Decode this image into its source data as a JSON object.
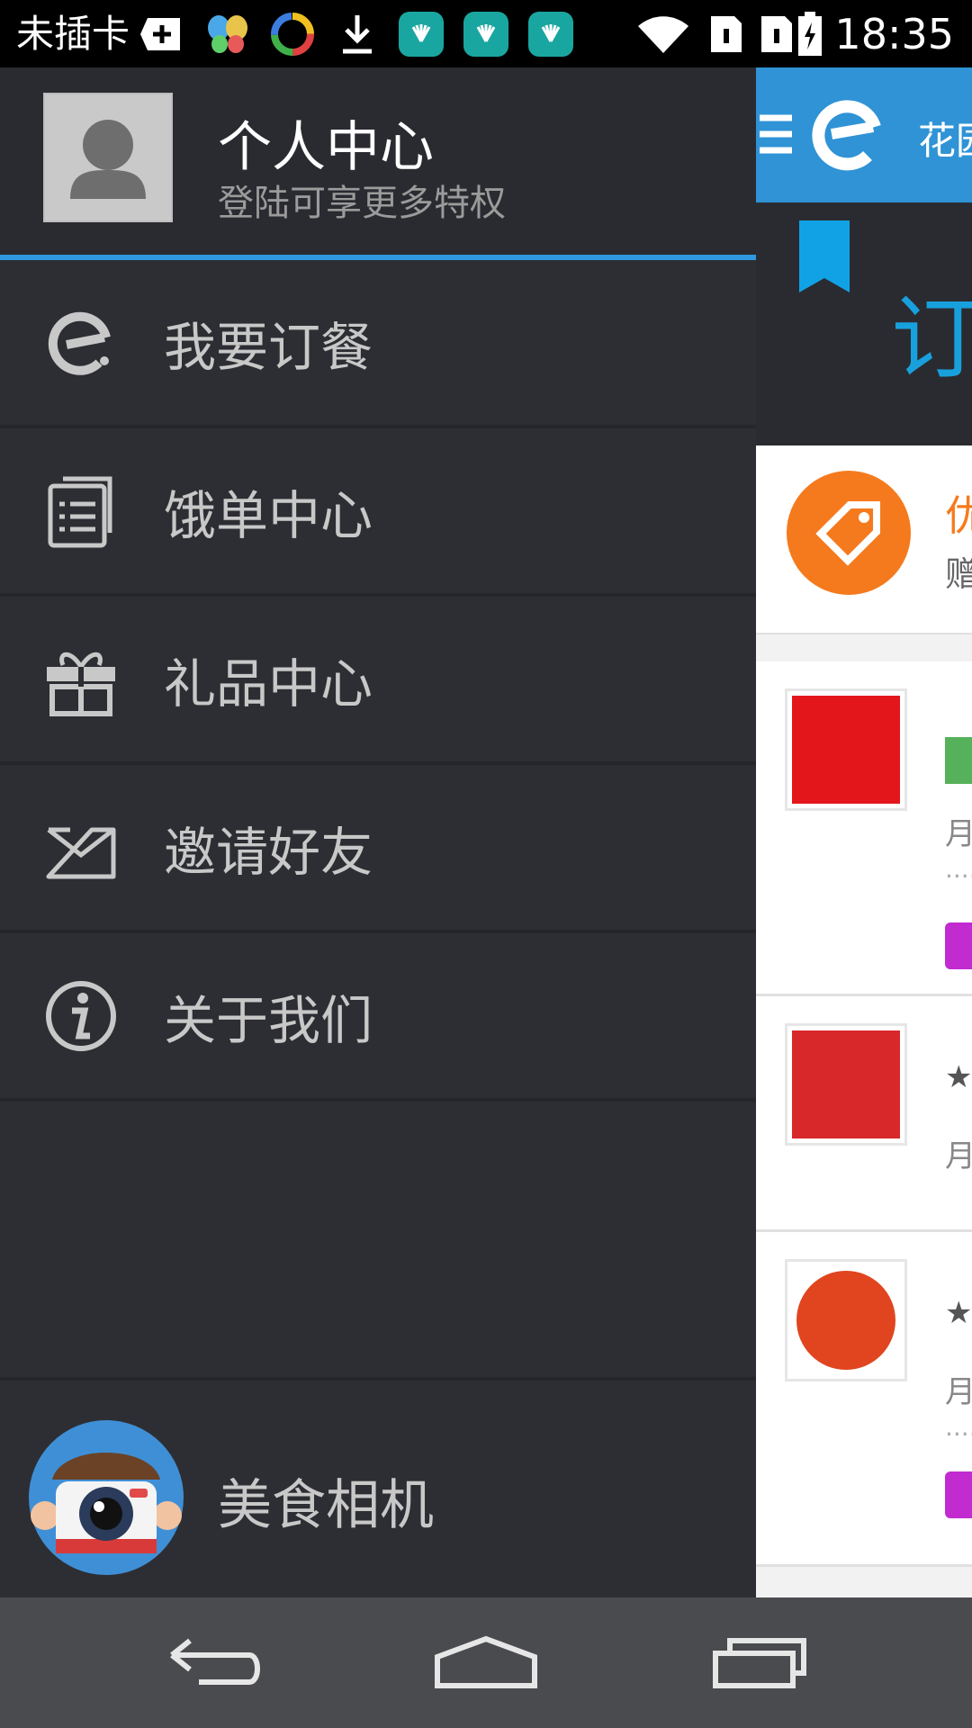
{
  "status_bar": {
    "carrier": "未插卡",
    "time": "18:35",
    "icons": [
      "add-icon",
      "butterfly-app-icon",
      "color-wheel-app-icon",
      "download-icon",
      "huawei-icon",
      "huawei-icon",
      "huawei-icon",
      "wifi-icon",
      "sim-icon",
      "sim-icon",
      "battery-icon"
    ]
  },
  "drawer": {
    "profile": {
      "title": "个人中心",
      "subtitle": "登陆可享更多特权"
    },
    "menu": [
      {
        "label": "我要订餐",
        "icon": "eleme-logo-icon"
      },
      {
        "label": "饿单中心",
        "icon": "document-icon"
      },
      {
        "label": "礼品中心",
        "icon": "gift-icon"
      },
      {
        "label": "邀请好友",
        "icon": "envelope-icon"
      },
      {
        "label": "关于我们",
        "icon": "info-icon"
      }
    ],
    "camera": {
      "label": "美食相机",
      "icon": "camera-icon"
    }
  },
  "background_app": {
    "header_title": "花园",
    "banner_text": "订",
    "promo_title": "优",
    "promo_sub": "赠",
    "card_glyphs": [
      "月",
      "月",
      "月"
    ]
  },
  "colors": {
    "drawer_bg": "#2d2e33",
    "accent_blue": "#2e98e0",
    "nav_bg": "#4a4b4f",
    "orange": "#f57a1d"
  }
}
